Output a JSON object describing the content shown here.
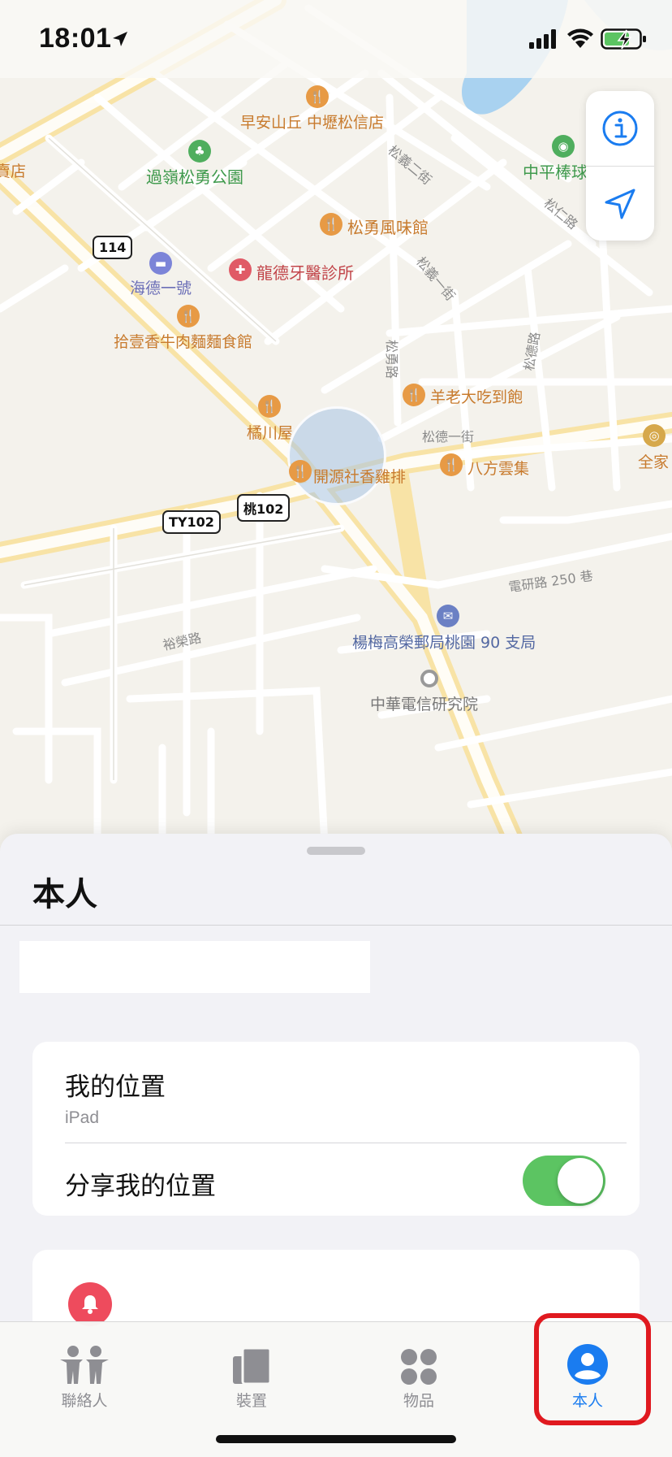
{
  "status_bar": {
    "time": "18:01"
  },
  "map": {
    "pois": [
      {
        "label": "早安山丘 中壢松信店",
        "color": "orange"
      },
      {
        "label": "過嶺松勇公園",
        "color": "green"
      },
      {
        "label": "松勇風味館",
        "color": "orange"
      },
      {
        "label": "龍德牙醫診所",
        "color": "red"
      },
      {
        "label": "海德一號",
        "color": "purple"
      },
      {
        "label": "拾壹香牛肉麵麵食館",
        "color": "orange"
      },
      {
        "label": "羊老大吃到飽",
        "color": "orange"
      },
      {
        "label": "橘川屋",
        "color": "orange"
      },
      {
        "label": "開源社香雞排",
        "color": "orange"
      },
      {
        "label": "八方雲集",
        "color": "orange"
      },
      {
        "label": "楊梅高榮郵局桃園 90 支局",
        "color": "blue"
      },
      {
        "label": "中華電信研究院",
        "color": "gray"
      },
      {
        "label": "中平棒球",
        "color": "green"
      },
      {
        "label": "全家",
        "color": "orange"
      },
      {
        "label": "賣店",
        "color": "orange"
      }
    ],
    "streets": [
      "松義二街",
      "松義一街",
      "松仁路",
      "松勇路",
      "松德路",
      "松德一街",
      "電研路 250 巷",
      "裕榮路"
    ],
    "shields": [
      "114",
      "TY102",
      "桃102"
    ]
  },
  "sheet": {
    "title": "本人",
    "my_location_label": "我的位置",
    "my_location_device": "iPad",
    "share_location_label": "分享我的位置",
    "share_location_on": true
  },
  "tabbar": {
    "tabs": [
      {
        "label": "聯絡人",
        "icon": "people-icon"
      },
      {
        "label": "裝置",
        "icon": "devices-icon"
      },
      {
        "label": "物品",
        "icon": "items-icon"
      },
      {
        "label": "本人",
        "icon": "person-icon",
        "active": true
      }
    ]
  },
  "colors": {
    "accent": "#1a7cf0",
    "toggle_on": "#5cc462",
    "highlight": "#e0191f",
    "notification": "#ee4b5d"
  }
}
